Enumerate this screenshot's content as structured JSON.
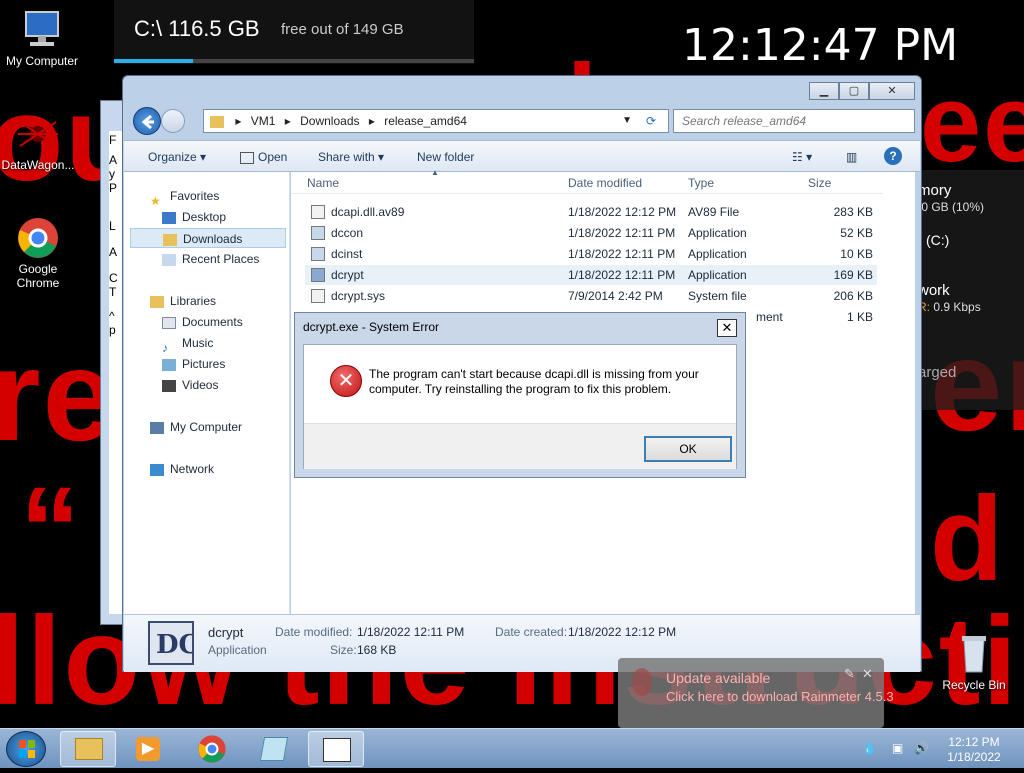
{
  "wallpaper": {
    "lines": [
      "ouy",
      "d",
      "ee",
      "re",
      "en",
      "“ „",
      "d",
      "llow the instruction"
    ]
  },
  "desktop_icons": [
    {
      "label": "My Computer"
    },
    {
      "label": "DataWagon..."
    },
    {
      "label": "Google Chrome"
    },
    {
      "label": "Recycle Bin"
    }
  ],
  "disk_widget": {
    "drive": "C:\\  116.5 GB",
    "free": "free out of 149 GB",
    "fill_percent": 22,
    "accent": "#2ab0e8"
  },
  "clock": "12:12:47 PM",
  "sys_widget": {
    "memory": "mory",
    "memory_detail": ".0 GB (10%)",
    "drive": "(C:)",
    "network": "work",
    "network_rate_prefix": "R:",
    "network_rate": "0.9 Kbps",
    "battery": "arged"
  },
  "background_window": {
    "lines": [
      "F",
      "A",
      "y",
      "P",
      "L",
      "A",
      "C",
      "T",
      "^",
      "p"
    ]
  },
  "explorer": {
    "breadcrumb": [
      "VM1",
      "Downloads",
      "release_amd64"
    ],
    "search_placeholder": "Search release_amd64",
    "toolbar": {
      "organize": "Organize",
      "open": "Open",
      "share_with": "Share with",
      "new_folder": "New folder"
    },
    "nav": {
      "favorites": "Favorites",
      "desktop": "Desktop",
      "downloads": "Downloads",
      "recent": "Recent Places",
      "libraries": "Libraries",
      "documents": "Documents",
      "music": "Music",
      "pictures": "Pictures",
      "videos": "Videos",
      "computer": "My Computer",
      "network": "Network"
    },
    "columns": {
      "name": "Name",
      "date": "Date modified",
      "type": "Type",
      "size": "Size"
    },
    "files": [
      {
        "name": "dcapi.dll.av89",
        "date": "1/18/2022 12:12 PM",
        "type": "AV89 File",
        "size": "283 KB"
      },
      {
        "name": "dccon",
        "date": "1/18/2022 12:11 PM",
        "type": "Application",
        "size": "52 KB"
      },
      {
        "name": "dcinst",
        "date": "1/18/2022 12:11 PM",
        "type": "Application",
        "size": "10 KB"
      },
      {
        "name": "dcrypt",
        "date": "1/18/2022 12:11 PM",
        "type": "Application",
        "size": "169 KB"
      },
      {
        "name": "dcrypt.sys",
        "date": "7/9/2014 2:42 PM",
        "type": "System file",
        "size": "206 KB"
      },
      {
        "name": "",
        "date": "",
        "type": "ment",
        "size": "1 KB"
      }
    ],
    "details": {
      "name": "dcrypt",
      "kind": "Application",
      "modified_label": "Date modified:",
      "modified": "1/18/2022 12:11 PM",
      "created_label": "Date created:",
      "created": "1/18/2022 12:12 PM",
      "size_label": "Size:",
      "size": "168 KB"
    }
  },
  "dialog": {
    "title": "dcrypt.exe - System Error",
    "message": "The program can't start because dcapi.dll is missing from your computer. Try reinstalling the program to fix this problem.",
    "ok": "OK"
  },
  "notification": {
    "title": "Update available",
    "body": "Click here to download Rainmeter 4.5.3"
  },
  "taskbar": {
    "time": "12:12 PM",
    "date": "1/18/2022"
  }
}
